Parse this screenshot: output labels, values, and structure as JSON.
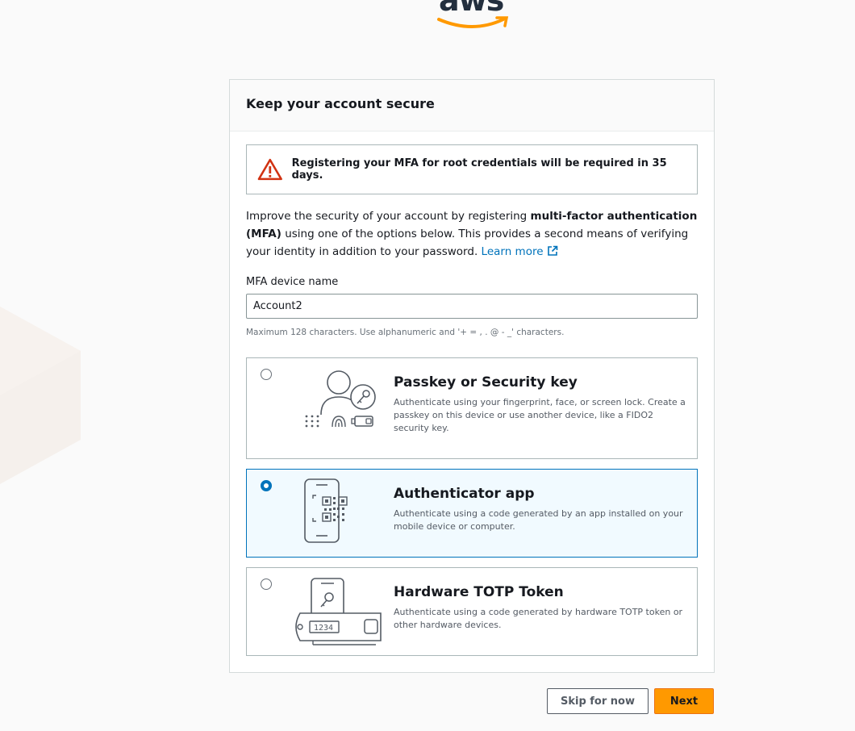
{
  "brand": {
    "logo_text": "aws",
    "accent_color": "#ff9900"
  },
  "card": {
    "title": "Keep your account secure",
    "alert": {
      "icon": "warning-icon",
      "text": "Registering your MFA for root credentials will be required in 35 days."
    },
    "intro": {
      "prefix": "Improve the security of your account by registering ",
      "bold": "multi-factor authentication (MFA)",
      "suffix": " using one of the options below. This provides a second means of verifying your identity in addition to your password. ",
      "link": "Learn more"
    },
    "device_name": {
      "label": "MFA device name",
      "value": "Account2",
      "hint": "Maximum 128 characters. Use alphanumeric and '+ = , . @ - _' characters."
    },
    "options": [
      {
        "title": "Passkey or Security key",
        "description": "Authenticate using your fingerprint, face, or screen lock. Create a passkey on this device or use another device, like a FIDO2 security key.",
        "selected": false
      },
      {
        "title": "Authenticator app",
        "description": "Authenticate using a code generated by an app installed on your mobile device or computer.",
        "selected": true
      },
      {
        "title": "Hardware TOTP Token",
        "description": "Authenticate using a code generated by hardware TOTP token or other hardware devices.",
        "selected": false,
        "token_display": "1234"
      }
    ]
  },
  "buttons": {
    "skip": "Skip for now",
    "next": "Next"
  }
}
